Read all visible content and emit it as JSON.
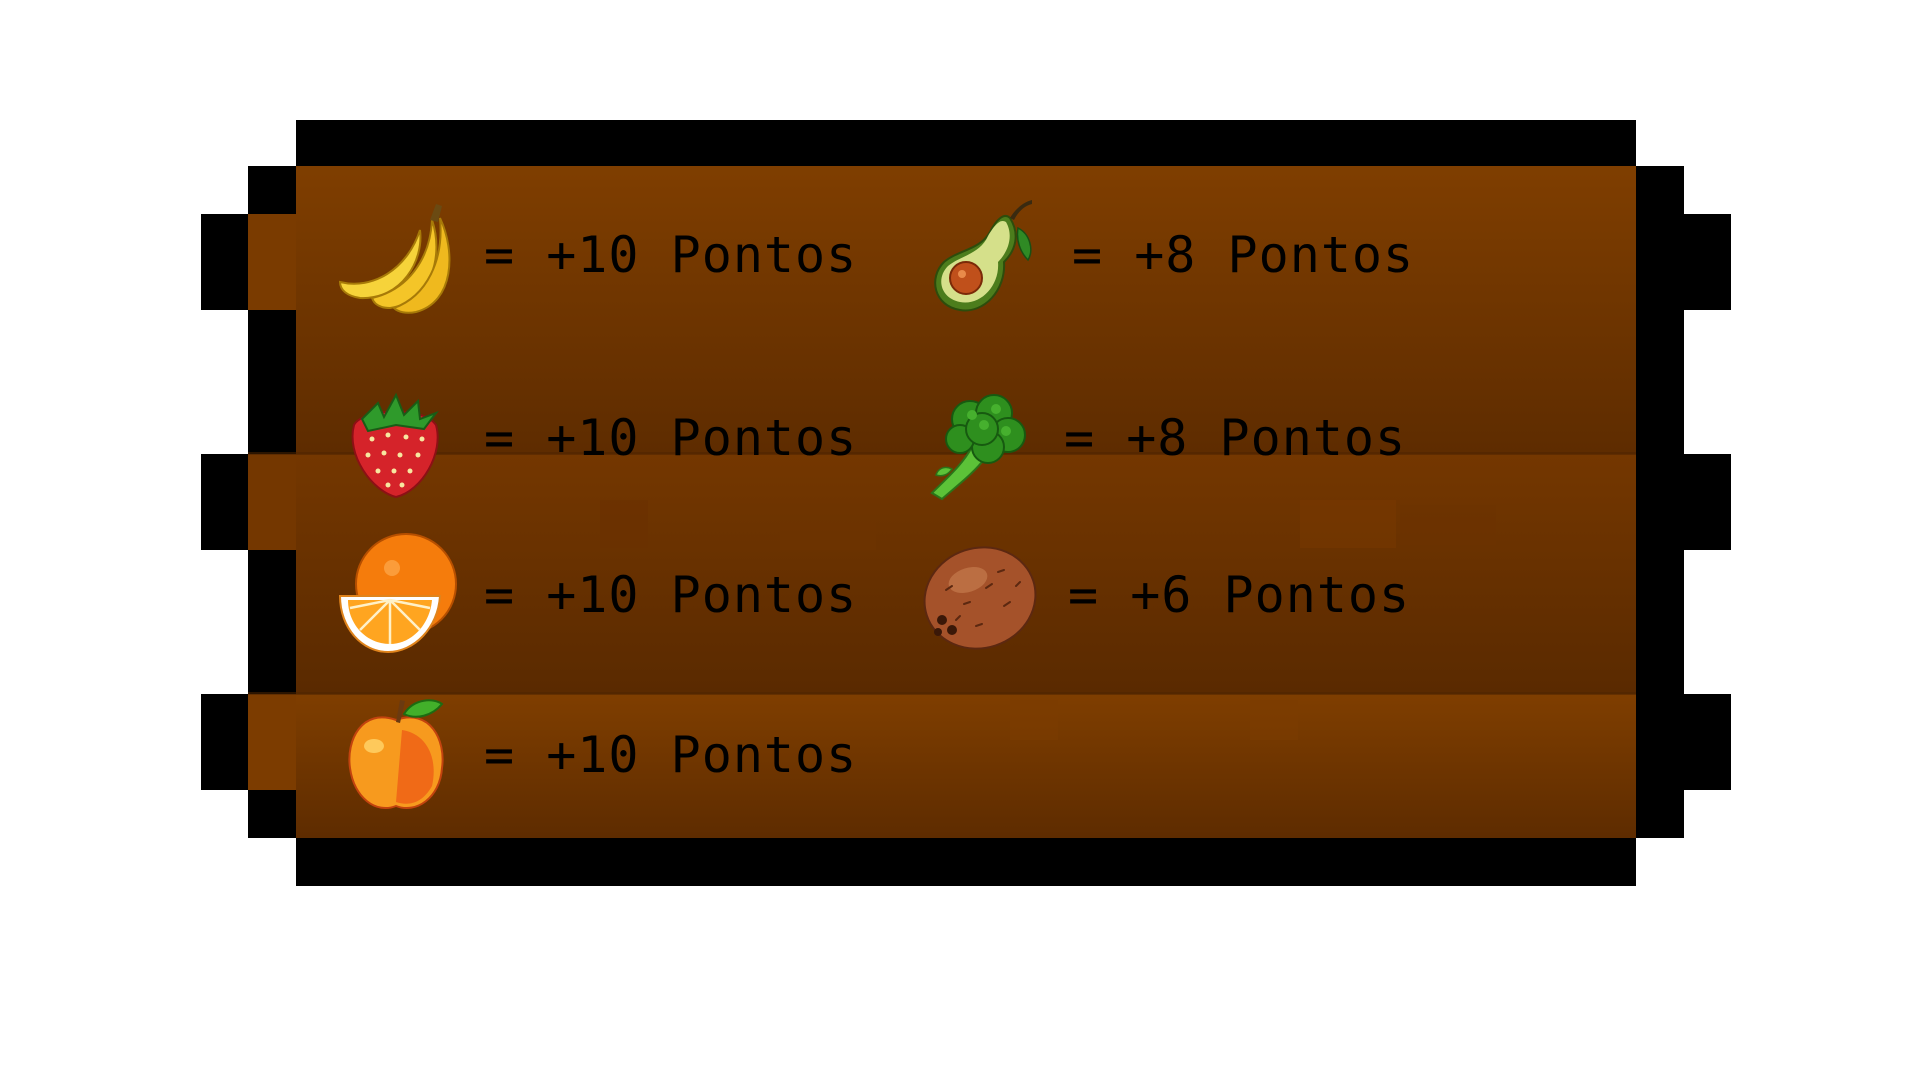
{
  "board": {
    "colors": {
      "border": "#000000",
      "wood_light": "#7f3e00",
      "wood_mid": "#6d3300",
      "wood_dark": "#5a2a00",
      "background": "#ffffff",
      "text": "#000000"
    },
    "items": [
      {
        "id": "banana",
        "icon": "banana-icon",
        "score": "= +10 Pontos"
      },
      {
        "id": "strawberry",
        "icon": "strawberry-icon",
        "score": "= +10 Pontos"
      },
      {
        "id": "orange",
        "icon": "orange-icon",
        "score": "= +10 Pontos"
      },
      {
        "id": "apple",
        "icon": "apple-icon",
        "score": "= +10 Pontos"
      },
      {
        "id": "avocado",
        "icon": "avocado-icon",
        "score": "= +8 Pontos"
      },
      {
        "id": "broccoli",
        "icon": "broccoli-icon",
        "score": "= +8 Pontos"
      },
      {
        "id": "coconut",
        "icon": "coconut-icon",
        "score": "= +6 Pontos"
      }
    ]
  }
}
